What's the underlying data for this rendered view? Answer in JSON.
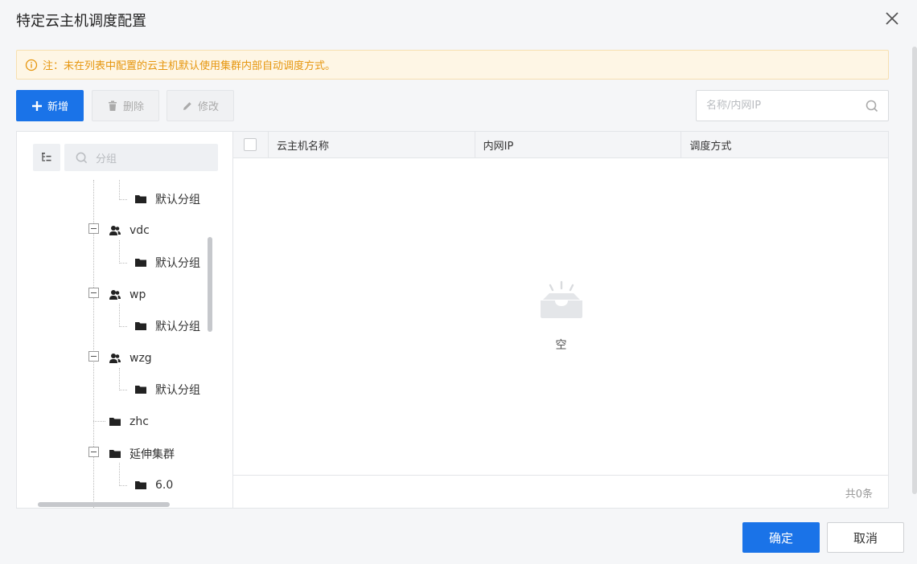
{
  "dialog": {
    "title": "特定云主机调度配置",
    "notice": "注：未在列表中配置的云主机默认使用集群内部自动调度方式。"
  },
  "toolbar": {
    "add_label": "新增",
    "delete_label": "删除",
    "edit_label": "修改",
    "search_placeholder": "名称/内网IP"
  },
  "tree": {
    "search_placeholder": "分组",
    "nodes": [
      {
        "label": "默认分组",
        "type": "folder"
      },
      {
        "label": "vdc",
        "type": "user-group",
        "expanded": true
      },
      {
        "label": "默认分组",
        "type": "folder"
      },
      {
        "label": "wp",
        "type": "user-group",
        "expanded": true
      },
      {
        "label": "默认分组",
        "type": "folder"
      },
      {
        "label": "wzg",
        "type": "user-group",
        "expanded": true
      },
      {
        "label": "默认分组",
        "type": "folder"
      },
      {
        "label": "zhc",
        "type": "folder"
      },
      {
        "label": "延伸集群",
        "type": "folder",
        "expanded": true
      },
      {
        "label": "6.0",
        "type": "folder"
      }
    ]
  },
  "table": {
    "columns": [
      "云主机名称",
      "内网IP",
      "调度方式"
    ],
    "empty_text": "空",
    "total_text": "共0条"
  },
  "footer": {
    "ok_label": "确定",
    "cancel_label": "取消"
  },
  "colors": {
    "primary": "#1a73e8",
    "notice_text": "#e6960f",
    "notice_bg": "#fef6e5"
  }
}
